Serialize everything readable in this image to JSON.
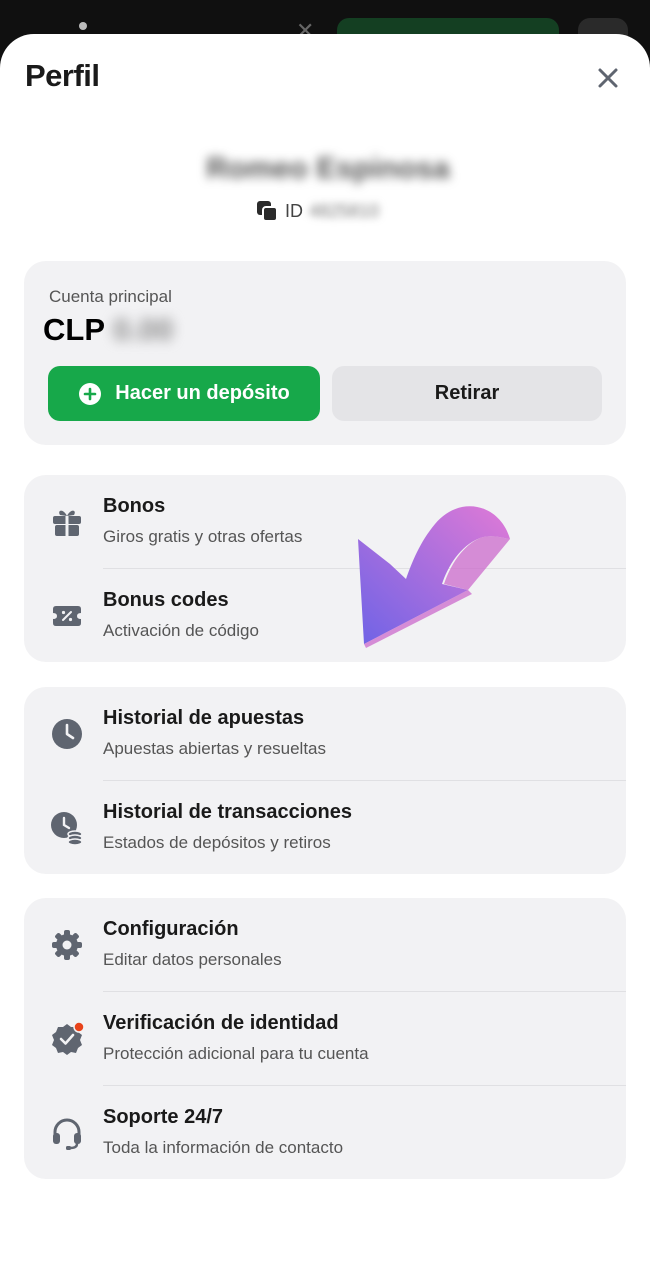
{
  "header": {
    "title": "Perfil"
  },
  "profile": {
    "username": "Romeo Espinosa",
    "id_label": "ID",
    "id_value": "4825810"
  },
  "balance": {
    "label": "Cuenta principal",
    "currency": "CLP",
    "amount": "0.00",
    "deposit_label": "Hacer un depósito",
    "withdraw_label": "Retirar"
  },
  "groups": [
    {
      "items": [
        {
          "title": "Bonos",
          "subtitle": "Giros gratis y otras ofertas",
          "icon": "gift-icon"
        },
        {
          "title": "Bonus codes",
          "subtitle": "Activación de código",
          "icon": "coupon-icon"
        }
      ]
    },
    {
      "items": [
        {
          "title": "Historial de apuestas",
          "subtitle": "Apuestas abiertas y resueltas",
          "icon": "clock-icon"
        },
        {
          "title": "Historial de transacciones",
          "subtitle": "Estados de depósitos y retiros",
          "icon": "history-coins-icon"
        }
      ]
    },
    {
      "items": [
        {
          "title": "Configuración",
          "subtitle": "Editar datos personales",
          "icon": "gear-icon"
        },
        {
          "title": "Verificación de identidad",
          "subtitle": "Protección adicional para tu cuenta",
          "icon": "verified-badge-icon"
        },
        {
          "title": "Soporte 24/7",
          "subtitle": "Toda la información de contacto",
          "icon": "headset-icon"
        }
      ]
    }
  ],
  "colors": {
    "accent": "#17a84a",
    "card": "#f2f2f4",
    "icon": "#5f6570",
    "alert_dot": "#e8431a",
    "arrow": "#c36be0"
  }
}
